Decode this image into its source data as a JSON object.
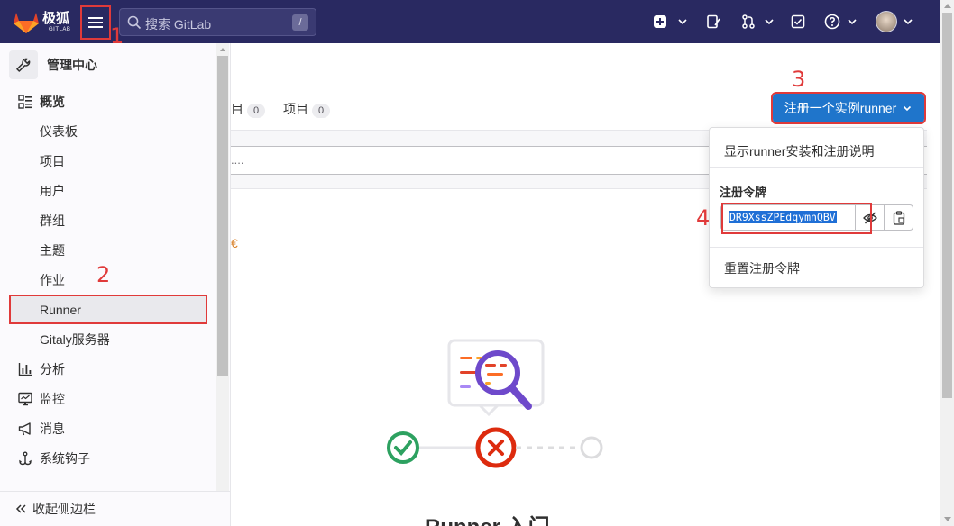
{
  "topbar": {
    "brand": "极狐",
    "brand_sub": "GITLAB",
    "search_placeholder": "搜索 GitLab",
    "search_shortcut": "/"
  },
  "sidebar": {
    "header": "管理中心",
    "items": [
      {
        "label": "概览",
        "icon": "overview-icon"
      },
      {
        "label": "仪表板"
      },
      {
        "label": "项目"
      },
      {
        "label": "用户"
      },
      {
        "label": "群组"
      },
      {
        "label": "主题"
      },
      {
        "label": "作业"
      },
      {
        "label": "Runner"
      },
      {
        "label": "Gitaly服务器"
      },
      {
        "label": "分析",
        "icon": "chart-icon"
      },
      {
        "label": "监控",
        "icon": "monitor-icon"
      },
      {
        "label": "消息",
        "icon": "megaphone-icon"
      },
      {
        "label": "系统钩子",
        "icon": "hook-icon"
      }
    ],
    "collapse_label": "收起侧边栏"
  },
  "main": {
    "tabs": [
      {
        "label": "目",
        "count": "0"
      },
      {
        "label": "项目",
        "count": "0"
      }
    ],
    "filter_placeholder": "....",
    "orange_fragment": "€",
    "register_button": "注册一个实例runner",
    "dropdown": {
      "show_instructions": "显示runner安装和注册说明",
      "token_label": "注册令牌",
      "token_value": "DR9XssZPEdqymnQBV",
      "reset_token": "重置注册令牌"
    },
    "empty_state_title": "Runner 入门"
  },
  "annotations": {
    "a1": "1",
    "a2": "2",
    "a3": "3",
    "a4": "4"
  },
  "colors": {
    "topbar": "#292961",
    "primary": "#1f75cb",
    "annotation": "#e03a3a"
  }
}
